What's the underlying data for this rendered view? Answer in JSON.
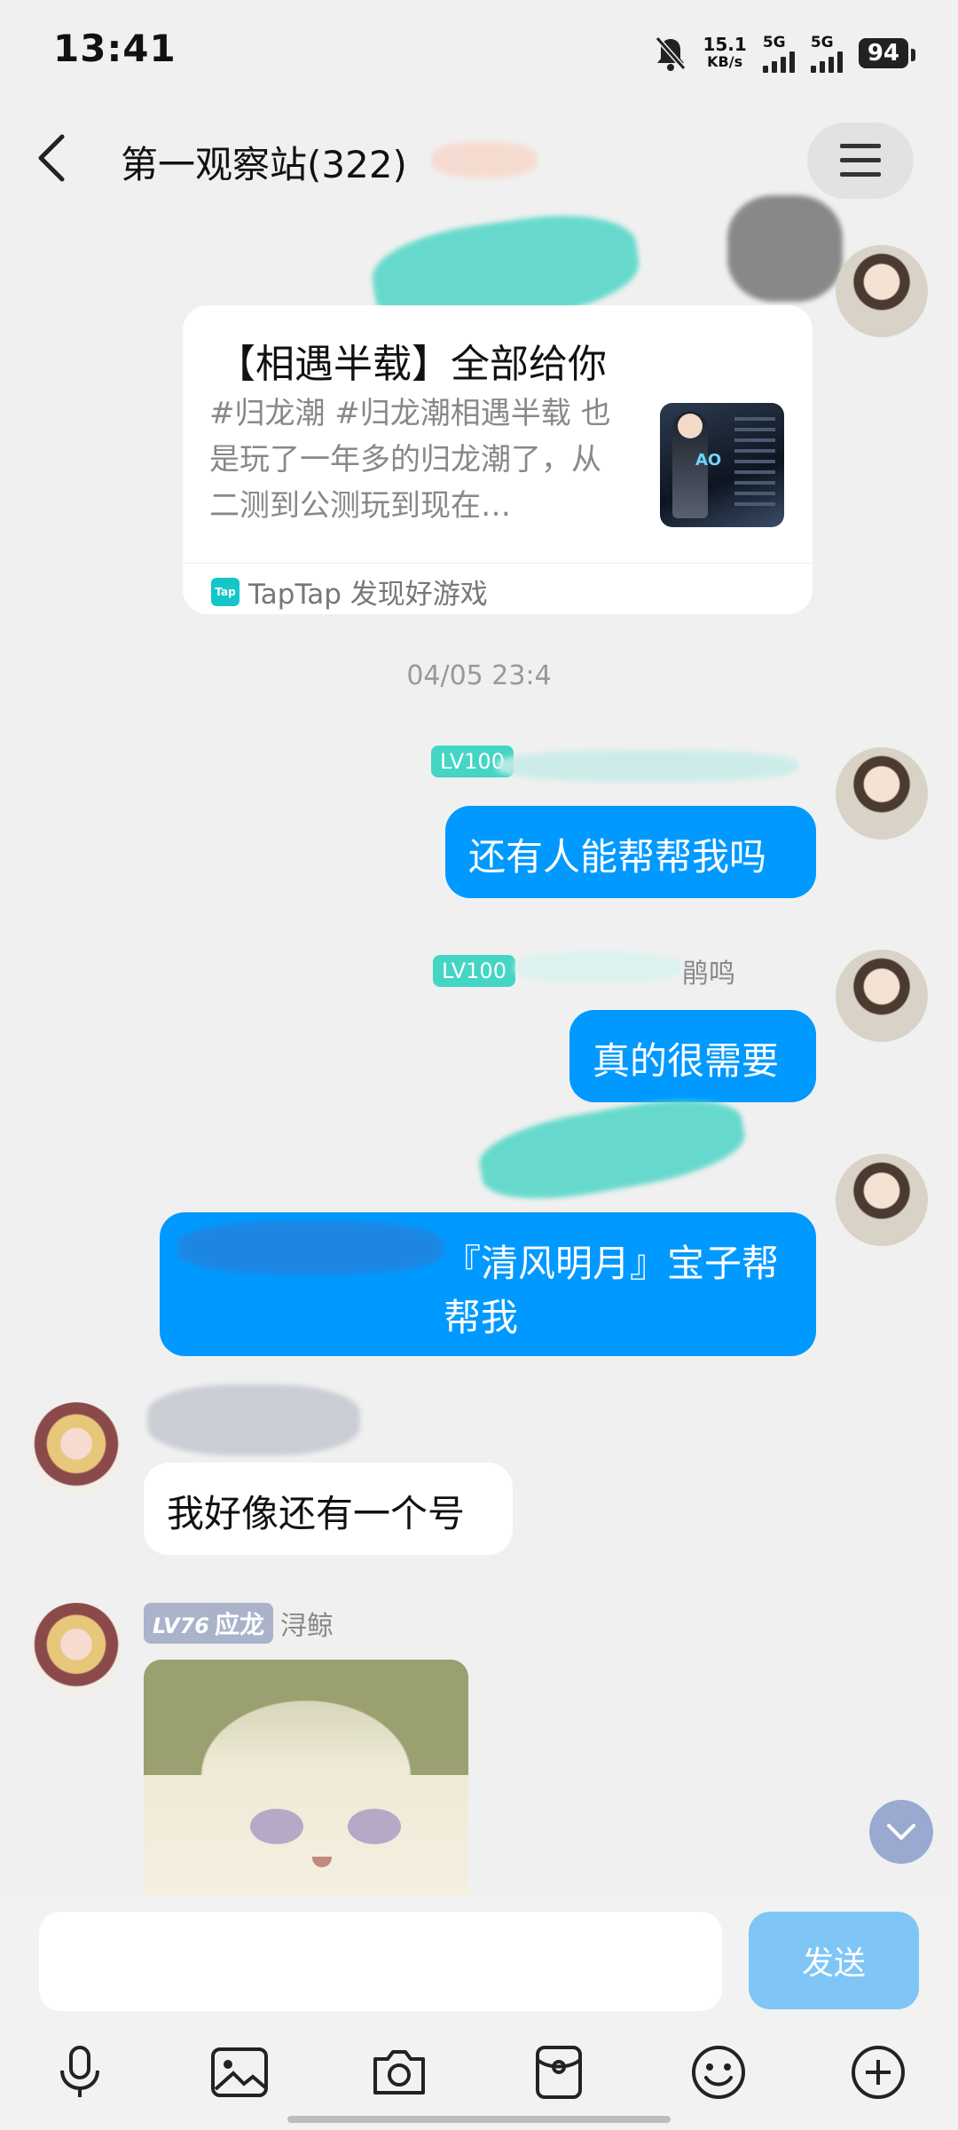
{
  "status_bar": {
    "time": "13:41",
    "net_speed_value": "15.1",
    "net_speed_unit": "KB/s",
    "sim1_label": "5G",
    "sim2_label": "5G",
    "battery": "94"
  },
  "header": {
    "title": "第一观察站(322)"
  },
  "link_card": {
    "title": "【相遇半载】全部给你",
    "description": "#归龙潮 #归龙潮相遇半载 也是玩了一年多的归龙潮了，从二测到公测玩到现在…",
    "thumb_label": "AO",
    "source_icon_text": "Tap",
    "source": "TapTap 发现好游戏"
  },
  "timestamp": "04/05 23:4",
  "messages": [
    {
      "side": "right",
      "badge": "LV100",
      "text": "还有人能帮帮我吗"
    },
    {
      "side": "right",
      "badge": "LV100",
      "sender": "鹃鸣",
      "text": "真的很需要"
    },
    {
      "side": "right",
      "text": "『清风明月』宝子帮帮我"
    },
    {
      "side": "left",
      "text": "我好像还有一个号"
    },
    {
      "side": "left",
      "badge_lv": "LV76",
      "badge_title": "应龙",
      "sender": "浔鲸"
    }
  ],
  "input": {
    "placeholder": "",
    "send_label": "发送"
  },
  "toolbar_icons": [
    "microphone-icon",
    "image-icon",
    "camera-icon",
    "red-packet-icon",
    "emoji-icon",
    "plus-icon"
  ]
}
